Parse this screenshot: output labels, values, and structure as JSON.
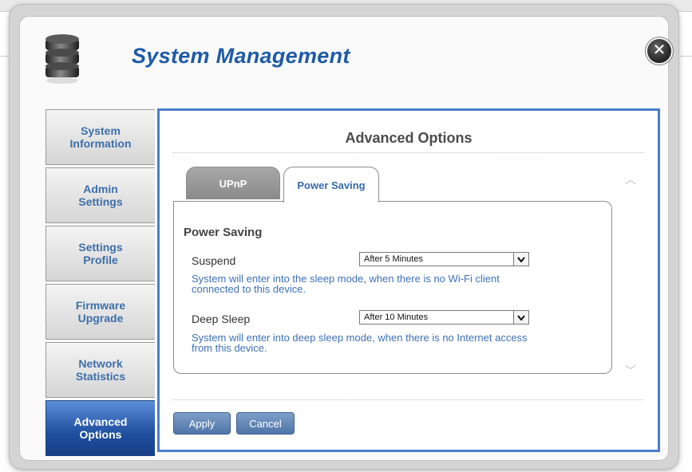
{
  "dialog": {
    "title": "System Management",
    "close_icon": "close-icon",
    "app_icon": "database-icon"
  },
  "sidebar": {
    "items": [
      {
        "line1": "System",
        "line2": "Information",
        "active": false
      },
      {
        "line1": "Admin",
        "line2": "Settings",
        "active": false
      },
      {
        "line1": "Settings",
        "line2": "Profile",
        "active": false
      },
      {
        "line1": "Firmware",
        "line2": "Upgrade",
        "active": false
      },
      {
        "line1": "Network",
        "line2": "Statistics",
        "active": false
      },
      {
        "line1": "Advanced",
        "line2": "Options",
        "active": true
      }
    ]
  },
  "content": {
    "title": "Advanced Options",
    "tabs": [
      {
        "label": "UPnP",
        "active": false
      },
      {
        "label": "Power Saving",
        "active": true
      }
    ],
    "panel": {
      "heading": "Power Saving",
      "suspend": {
        "label": "Suspend",
        "value": "After 5 Minutes",
        "description_line1": "System will enter into the sleep mode, when there is no Wi-Fi client",
        "description_line2": "connected to this device."
      },
      "deep_sleep": {
        "label": "Deep Sleep",
        "value": "After 10 Minutes",
        "description_line1": "System will enter into deep sleep mode, when there is no Internet access",
        "description_line2": "from this device."
      }
    },
    "buttons": {
      "apply": "Apply",
      "cancel": "Cancel"
    }
  },
  "colors": {
    "accent": "#1e5aa6",
    "active_nav": "#1f4f9f",
    "content_border": "#4a7dc8",
    "description_text": "#3d71b8"
  }
}
